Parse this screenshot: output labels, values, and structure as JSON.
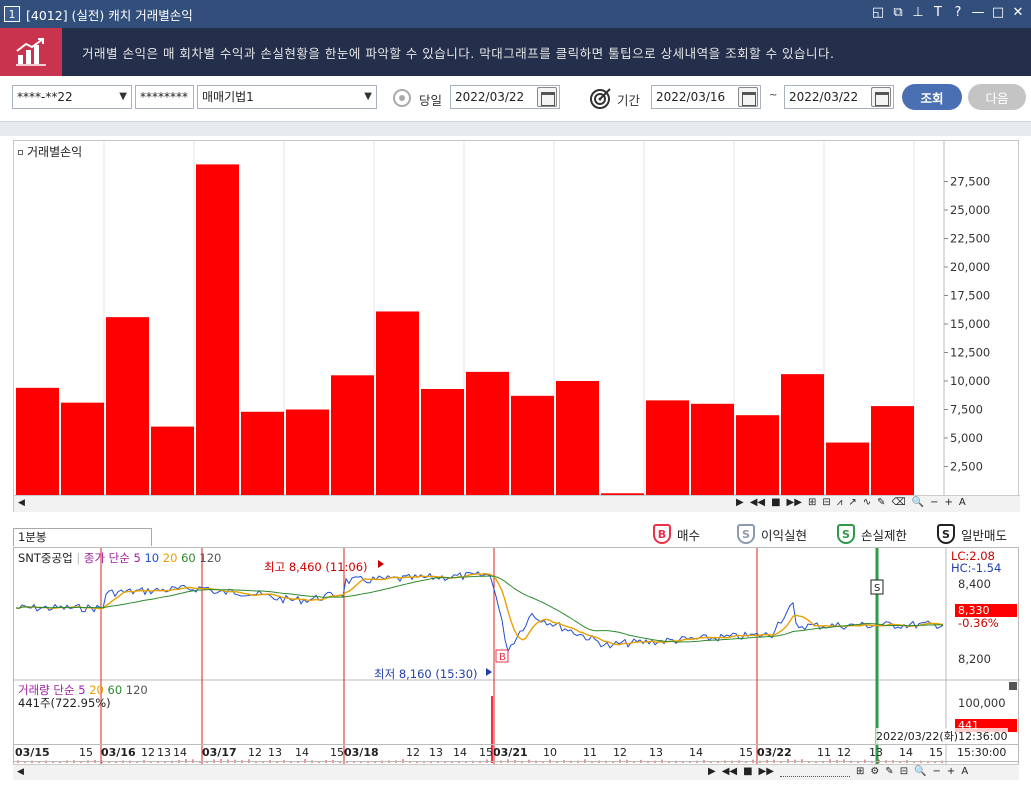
{
  "window": {
    "number": "1",
    "title": "[4012] (실전) 캐치 거래별손익",
    "controls": [
      "□",
      "⧉",
      "📌",
      "T",
      "?",
      "—",
      "□",
      "✕"
    ]
  },
  "banner": {
    "text": "거래별 손익은 매 회차별 수익과 손실현황을 한눈에 파악할 수 있습니다. 막대그래프를 클릭하면 툴팁으로 상세내역을 조회할 수 있습니다."
  },
  "toolbar": {
    "account": "****-**22",
    "password": "********",
    "strategy": "매매기법1",
    "day_label": "당일",
    "day_date": "2022/03/22",
    "period_label": "기간",
    "from_date": "2022/03/16",
    "tilde": "~",
    "to_date": "2022/03/22",
    "query_label": "조회",
    "next_label": "다음"
  },
  "chart_data": [
    {
      "type": "bar",
      "title": "거래별손익",
      "values": [
        9400,
        8100,
        15600,
        6000,
        29000,
        7300,
        7500,
        10500,
        16100,
        9300,
        10800,
        8700,
        10000,
        150,
        8300,
        8000,
        7000,
        10600,
        4600,
        7800
      ],
      "ylim": [
        0,
        30000
      ],
      "yticks": [
        "2,500",
        "5,000",
        "7,500",
        "10,000",
        "12,500",
        "15,000",
        "17,500",
        "20,000",
        "22,500",
        "25,000",
        "27,500"
      ],
      "colors": {
        "bar": "#ff0000"
      }
    }
  ],
  "lower_chart": {
    "tab_label": "1분봉",
    "legend": [
      {
        "icon": "B",
        "label": "매수",
        "color": "#e8334a"
      },
      {
        "icon": "S",
        "label": "이익실현",
        "color": "#8a9bb3"
      },
      {
        "icon": "S",
        "label": "손실제한",
        "color": "#2e9a4a"
      },
      {
        "icon": "S",
        "label": "일반매도",
        "color": "#222222"
      }
    ],
    "stock_name": "SNT중공업",
    "ma_legend": {
      "prefix": "종가 단순",
      "periods": [
        "5",
        "10",
        "20",
        "60",
        "120"
      ]
    },
    "high_label": "최고 8,460 (11:06)",
    "low_label": "최저 8,160 (15:30)",
    "lc": "LC:2.08",
    "hc": "HC:-1.54",
    "price_ticks": [
      "8,400",
      "8,200"
    ],
    "current_price": "8,330",
    "change_pct": "-0.36%",
    "volume_title": "거래량 단순",
    "volume_periods": [
      "5",
      "20",
      "60",
      "120"
    ],
    "volume_value": "441주(722.95%)",
    "volume_tick": "100,000",
    "volume_current": "441",
    "timestamp": "2022/03/22(화)12:36:00",
    "x_labels": [
      "03/15",
      "15",
      "03/16",
      "12",
      "13",
      "14",
      "03/17",
      "12",
      "13",
      "14",
      "15",
      "03/18",
      "12",
      "13",
      "14",
      "15",
      "03/21",
      "10",
      "11",
      "12",
      "13",
      "14",
      "15",
      "03/22",
      "11",
      "12",
      "13",
      "14",
      "15",
      "15:30:00"
    ],
    "trade_marks": [
      "B",
      "S"
    ]
  }
}
